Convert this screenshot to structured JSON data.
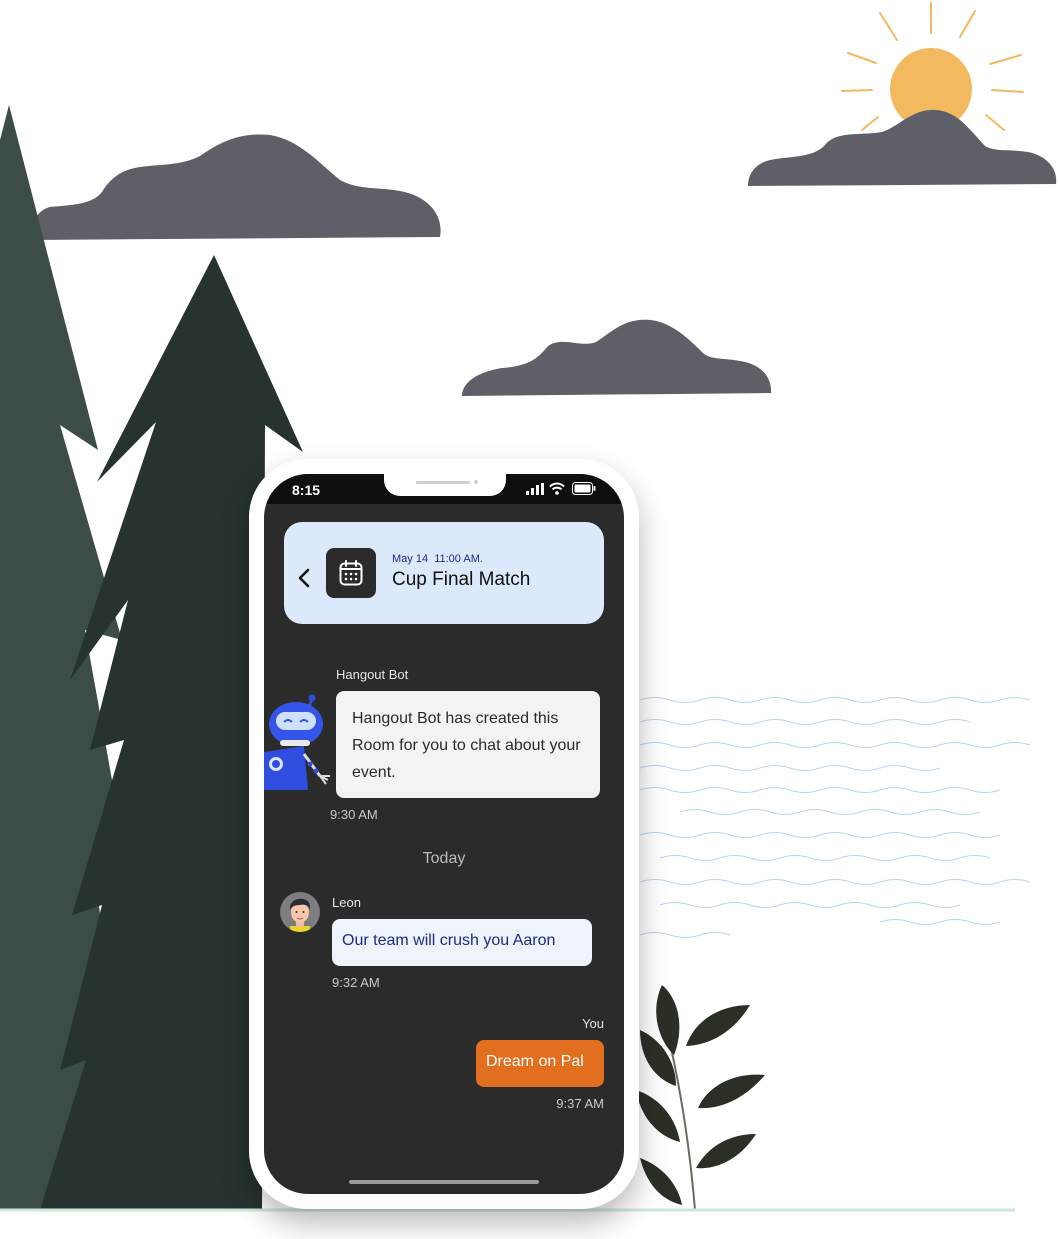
{
  "status_bar": {
    "time": "8:15"
  },
  "event": {
    "date": "May 14",
    "time": "11:00 AM.",
    "title": "Cup Final Match"
  },
  "icons": {
    "back": "chevron-left-icon",
    "calendar": "calendar-icon",
    "signal": "signal-icon",
    "wifi": "wifi-icon",
    "battery": "battery-icon"
  },
  "chat": {
    "bot": {
      "sender": "Hangout Bot",
      "text": "Hangout Bot has created this Room for you to chat about your event.",
      "time": "9:30 AM"
    },
    "divider": "Today",
    "messages": [
      {
        "sender": "Leon",
        "text": "Our team will crush you Aaron",
        "time": "9:32 AM"
      },
      {
        "sender": "You",
        "text": "Dream on Pal",
        "time": "9:37 AM"
      }
    ]
  },
  "colors": {
    "screen_bg": "#2b2b2b",
    "event_card": "#dbe9fb",
    "outgoing_bubble": "#e16f1f",
    "incoming_bubble": "#eef3fc",
    "bot_bubble": "#f3f3f3",
    "accent_navy": "#1e2a87",
    "sun": "#f3b95f",
    "cloud": "#5f5f67",
    "tree_light": "#3c4d47",
    "tree_dark": "#263330"
  }
}
